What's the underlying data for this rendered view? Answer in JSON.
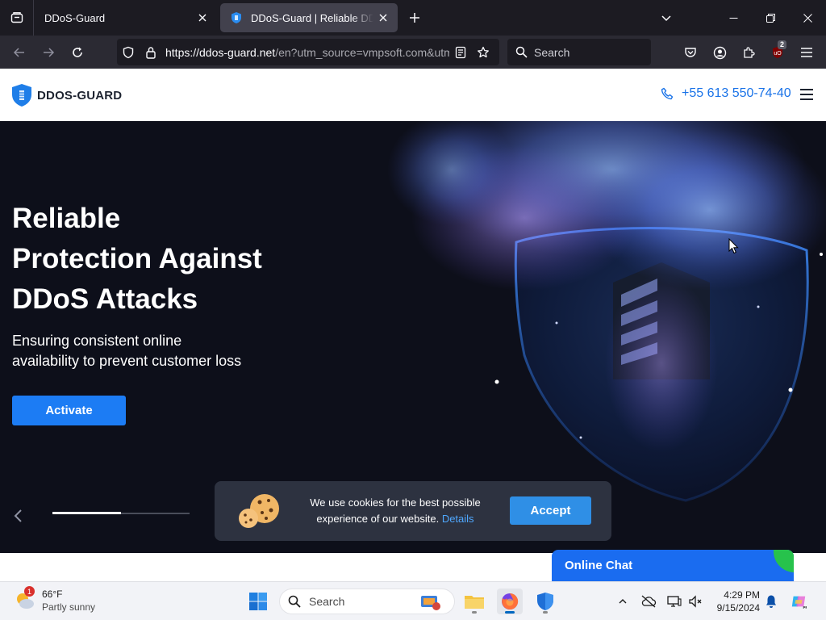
{
  "browser": {
    "tabs": [
      {
        "title": "DDoS-Guard",
        "active": false
      },
      {
        "title": "DDoS-Guard | Reliable DDoS Protection",
        "active": true
      }
    ],
    "url_main": "https://ddos-guard.net",
    "url_rest": "/en?utm_source=vmpsoft.com&utm",
    "search_placeholder": "Search",
    "extension_badge": "2"
  },
  "site": {
    "logo_text": "DDOS-GUARD",
    "phone": "+55 613 550-74-40",
    "hero": {
      "title_line1": "Reliable",
      "title_line2": "Protection Against",
      "title_line3": "DDoS Attacks",
      "subtitle_line1": "Ensuring consistent online",
      "subtitle_line2": "availability to prevent customer loss",
      "cta_label": "Activate"
    },
    "slider_progress": 0.5,
    "cookie": {
      "text_line1": "We use cookies for the best possible",
      "text_line2": "experience of our website.",
      "link_label": "Details",
      "accept_label": "Accept"
    },
    "chat_label": "Online Chat"
  },
  "taskbar": {
    "weather_temp": "66°F",
    "weather_condition": "Partly sunny",
    "weather_badge": "1",
    "search_placeholder": "Search",
    "time": "4:29 PM",
    "date": "9/15/2024"
  },
  "colors": {
    "accent_blue": "#1c7cf4",
    "chat_blue": "#1a6cf0",
    "hero_bg": "#0d0f1a",
    "browser_dark": "#1c1b22"
  }
}
